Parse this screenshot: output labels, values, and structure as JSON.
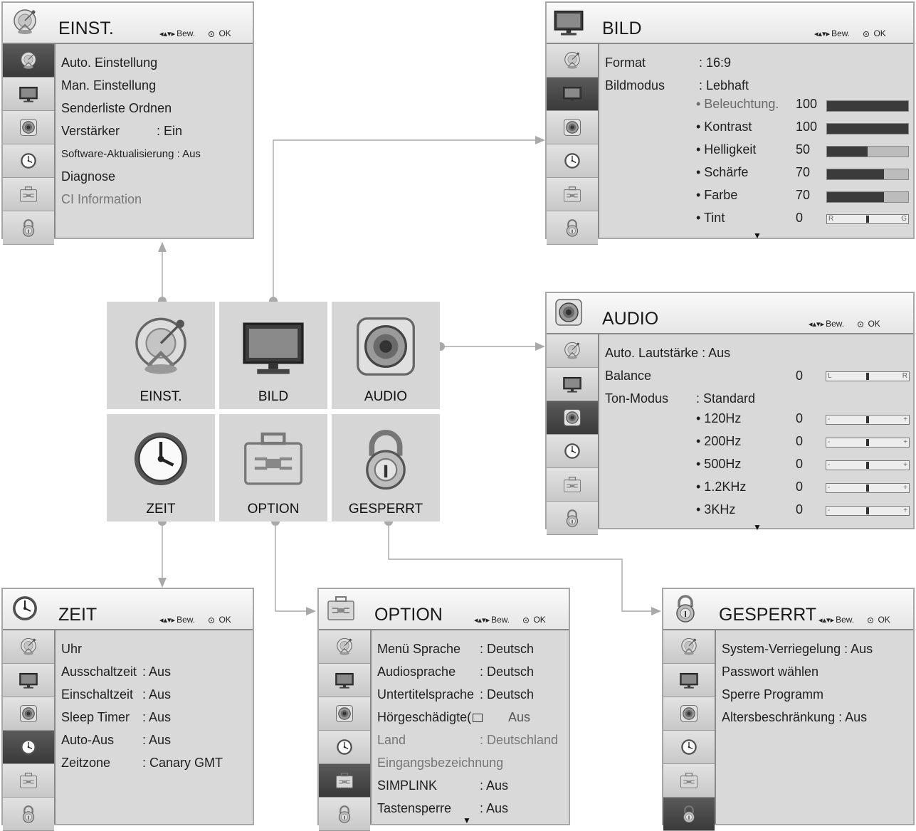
{
  "hint": {
    "move": "Bew.",
    "ok": "OK"
  },
  "icons": {
    "einst": "satellite-dish-icon",
    "bild": "tv-monitor-icon",
    "audio": "speaker-icon",
    "zeit": "clock-icon",
    "option": "toolbox-icon",
    "gesperrt": "padlock-icon"
  },
  "main_menu": {
    "einst": "EINST.",
    "bild": "BILD",
    "audio": "AUDIO",
    "zeit": "ZEIT",
    "option": "OPTION",
    "gesperrt": "GESPERRT"
  },
  "einst_window": {
    "title": "EINST.",
    "items": [
      {
        "label": "Auto. Einstellung"
      },
      {
        "label": "Man. Einstellung"
      },
      {
        "label": "Senderliste Ordnen"
      },
      {
        "label": "Verstärker",
        "value": ": Ein"
      },
      {
        "label": "Software-Aktualisierung : Aus"
      },
      {
        "label": "Diagnose"
      },
      {
        "label": "CI Information"
      }
    ]
  },
  "bild_window": {
    "title": "BILD",
    "format_label": "Format",
    "format_value": ": 16:9",
    "mode_label": "Bildmodus",
    "mode_value": ": Lebhaft",
    "settings": [
      {
        "label": "• Beleuchtung.",
        "value": "100",
        "fraction": 1.0
      },
      {
        "label": "• Kontrast",
        "value": "100",
        "fraction": 1.0
      },
      {
        "label": "• Helligkeit",
        "value": "50",
        "fraction": 0.5
      },
      {
        "label": "• Schärfe",
        "value": "70",
        "fraction": 0.7
      },
      {
        "label": "• Farbe",
        "value": "70",
        "fraction": 0.7
      },
      {
        "label": "• Tint",
        "value": "0",
        "left": "R",
        "right": "G"
      }
    ]
  },
  "audio_window": {
    "title": "AUDIO",
    "auto_volume": "Auto. Lautstärke : Aus",
    "balance_label": "Balance",
    "balance_value": "0",
    "balance_left": "L",
    "balance_right": "R",
    "mode_label": "Ton-Modus",
    "mode_value": ": Standard",
    "bands": [
      {
        "label": "• 120Hz",
        "value": "0"
      },
      {
        "label": "• 200Hz",
        "value": "0"
      },
      {
        "label": "• 500Hz",
        "value": "0"
      },
      {
        "label": "• 1.2KHz",
        "value": "0"
      },
      {
        "label": "• 3KHz",
        "value": "0"
      }
    ],
    "band_left": "-",
    "band_right": "+"
  },
  "zeit_window": {
    "title": "ZEIT",
    "items": [
      {
        "label": "Uhr",
        "value": ""
      },
      {
        "label": "Ausschaltzeit",
        "value": ": Aus"
      },
      {
        "label": "Einschaltzeit",
        "value": ": Aus"
      },
      {
        "label": "Sleep Timer",
        "value": ": Aus"
      },
      {
        "label": "Auto-Aus",
        "value": ": Aus"
      },
      {
        "label": "Zeitzone",
        "value": ": Canary GMT"
      }
    ]
  },
  "option_window": {
    "title": "OPTION",
    "items": [
      {
        "label": "Menü Sprache",
        "value": ": Deutsch"
      },
      {
        "label": "Audiosprache",
        "value": ": Deutsch"
      },
      {
        "label": "Untertitelsprache",
        "value": ": Deutsch"
      },
      {
        "label": "Hörgeschädigte(",
        "value": "Aus"
      },
      {
        "label": "Land",
        "value": ": Deutschland"
      },
      {
        "label": "Eingangsbezeichnung",
        "value": ""
      },
      {
        "label": "SIMPLINK",
        "value": ": Aus"
      },
      {
        "label": "Tastensperre",
        "value": ": Aus"
      }
    ]
  },
  "gesperrt_window": {
    "title": "GESPERRT",
    "items": [
      {
        "label": "System-Verriegelung : Aus"
      },
      {
        "label": "Passwort wählen"
      },
      {
        "label": "Sperre Programm"
      },
      {
        "label": "Altersbeschränkung : Aus"
      }
    ]
  },
  "colors": {
    "fill": "#3b3b3b",
    "bar_bg": "#bcbcbc",
    "connector": "#9a9a9a",
    "panel": "#d9d9d9"
  }
}
